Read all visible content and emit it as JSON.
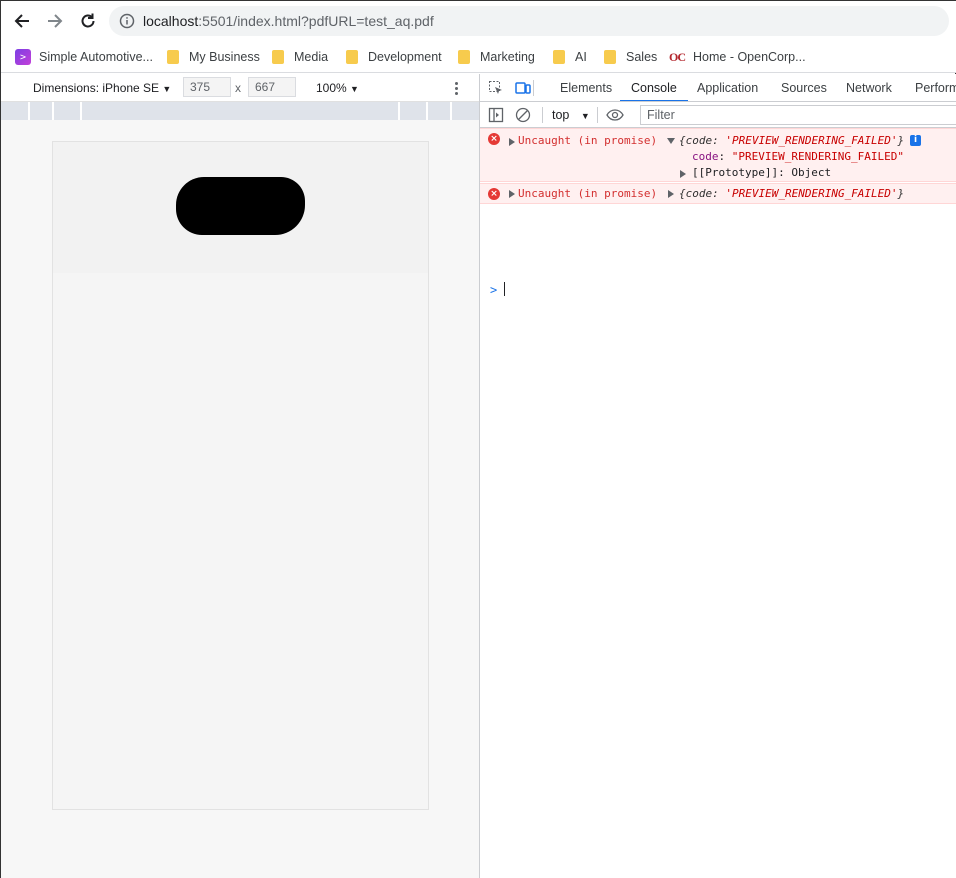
{
  "browser": {
    "url_host": "localhost",
    "url_rest": ":5501/index.html?pdfURL=test_aq.pdf"
  },
  "bookmarks": [
    {
      "label": "Simple Automotive...",
      "icon": "app-icon"
    },
    {
      "label": "My Business",
      "icon": "folder-icon"
    },
    {
      "label": "Media",
      "icon": "folder-icon"
    },
    {
      "label": "Development",
      "icon": "folder-icon"
    },
    {
      "label": "Marketing",
      "icon": "folder-icon"
    },
    {
      "label": "AI",
      "icon": "folder-icon"
    },
    {
      "label": "Sales",
      "icon": "folder-icon"
    },
    {
      "label": "Home - OpenCorp...",
      "icon": "oc-logo",
      "logo_text": "OC"
    }
  ],
  "device_toolbar": {
    "dimensions_label": "Dimensions: iPhone SE",
    "width_value": "375",
    "times": "x",
    "height_value": "667",
    "zoom": "100%"
  },
  "devtools": {
    "tabs": [
      "Elements",
      "Console",
      "Application",
      "Sources",
      "Network",
      "Perform"
    ],
    "active_tab": "Console",
    "context": "top",
    "filter_placeholder": "Filter"
  },
  "console": {
    "errors": [
      {
        "prefix": "Uncaught (in promise)",
        "summary_open": "{code: ",
        "summary_value": "'PREVIEW_RENDERING_FAILED'",
        "summary_close": "}",
        "expanded": true,
        "props": [
          {
            "key": "code",
            "value": "\"PREVIEW_RENDERING_FAILED\""
          },
          {
            "key": "[[Prototype]]",
            "value": "Object"
          }
        ]
      },
      {
        "prefix": "Uncaught (in promise)",
        "summary_open": "{code: ",
        "summary_value": "'PREVIEW_RENDERING_FAILED'",
        "summary_close": "}",
        "expanded": false
      }
    ],
    "prompt": ">"
  },
  "colors": {
    "accent": "#1a73e8",
    "error": "#d32f2f",
    "error_bg": "#fff0f0"
  }
}
